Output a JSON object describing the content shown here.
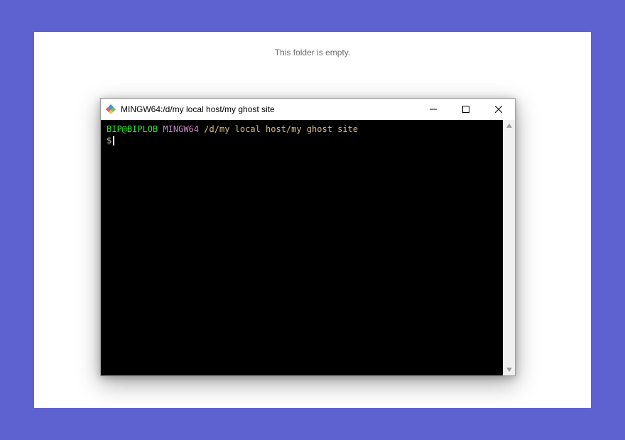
{
  "explorer": {
    "empty_message": "This folder is empty."
  },
  "terminal": {
    "title": "MINGW64:/d/my local host/my ghost site",
    "prompt": {
      "user": "BIP@BIPLOB",
      "system": "MINGW64",
      "path": "/d/my local host/my ghost site",
      "prompt_char": "$"
    }
  }
}
